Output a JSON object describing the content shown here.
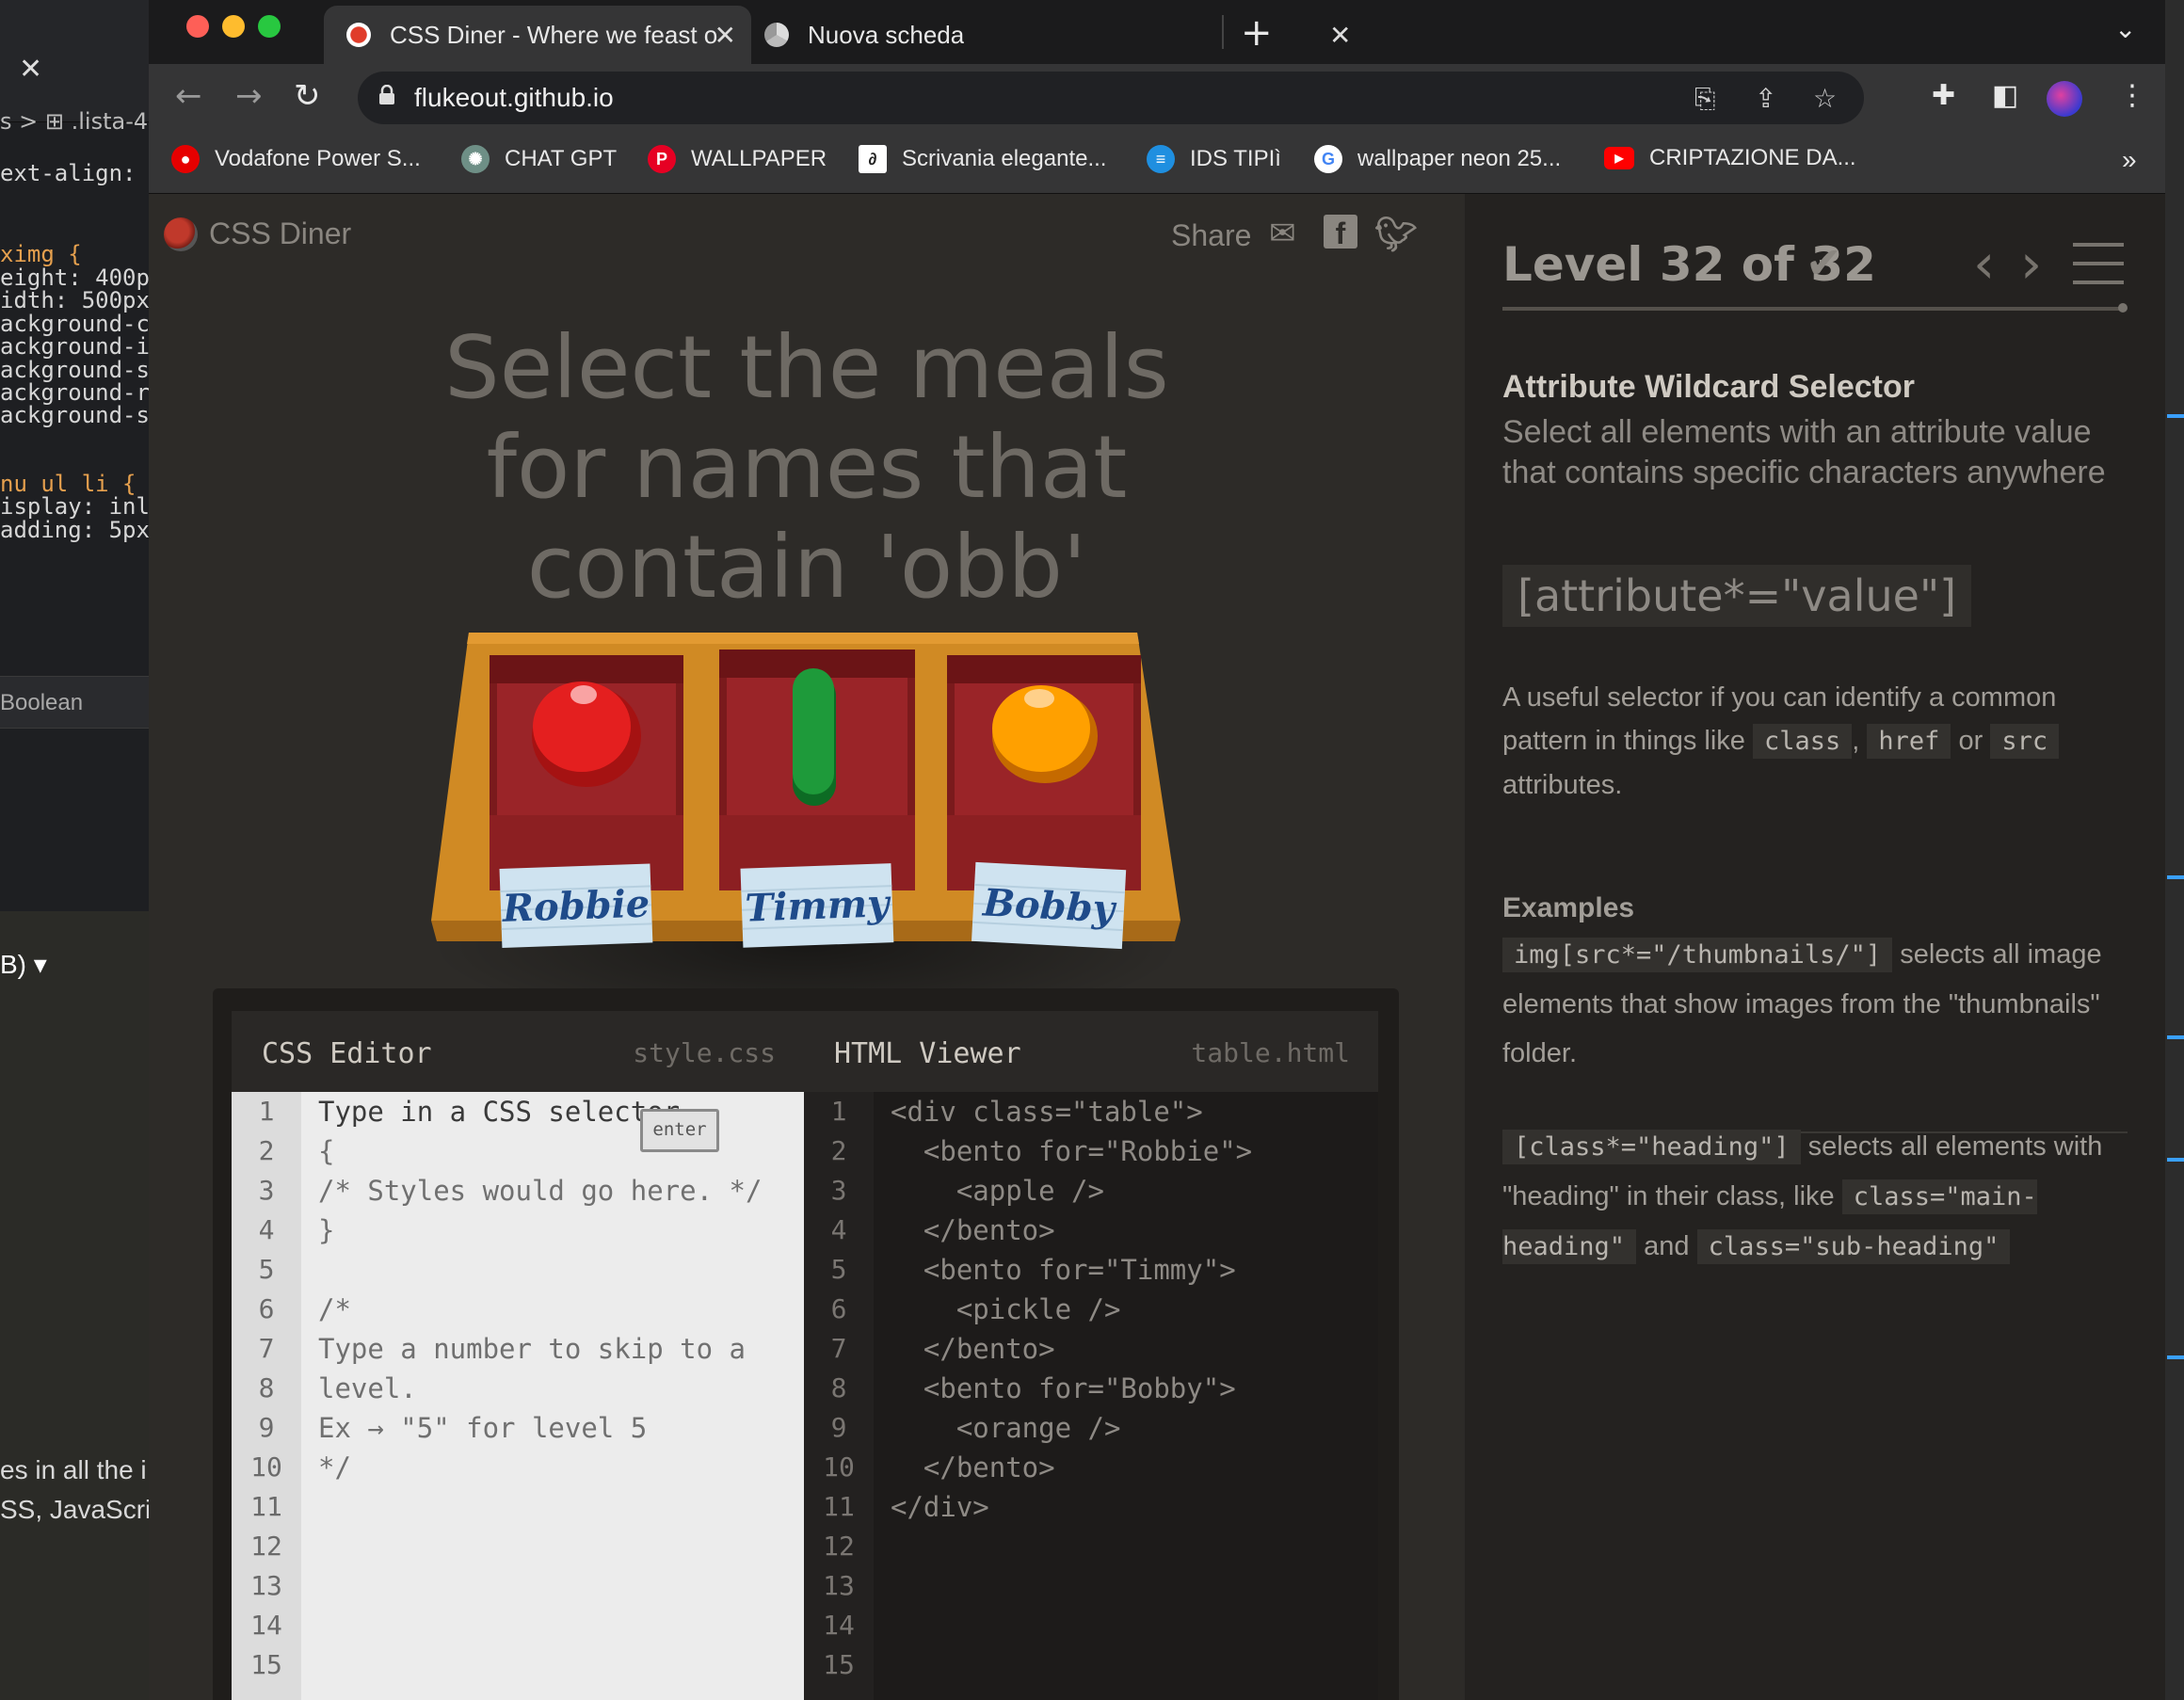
{
  "background_window": {
    "breadcrumb": "s > ⊞ .lista-4",
    "code_lines": [
      {
        "text": "ext-align:",
        "kind": "prop"
      },
      {
        "text": "ximg {",
        "kind": "sel"
      },
      {
        "text": "eight: 400p",
        "kind": "prop"
      },
      {
        "text": "idth: 500px",
        "kind": "prop"
      },
      {
        "text": "ackground-c",
        "kind": "prop"
      },
      {
        "text": "ackground-i",
        "kind": "prop"
      },
      {
        "text": "ackground-s",
        "kind": "prop"
      },
      {
        "text": "ackground-r",
        "kind": "prop"
      },
      {
        "text": "ackground-s",
        "kind": "prop"
      },
      {
        "text": "nu ul li {",
        "kind": "sel"
      },
      {
        "text": "isplay: inl",
        "kind": "prop"
      },
      {
        "text": "adding: 5px",
        "kind": "prop"
      }
    ],
    "boolean_label": "Boolean",
    "dropdown_label": "B) ▾",
    "lower_text_1": "es in all the i",
    "lower_text_2": "SS, JavaScri"
  },
  "browser": {
    "tabs": [
      {
        "title": "CSS Diner - Where we feast on",
        "active": true
      },
      {
        "title": "Nuova scheda",
        "active": false
      }
    ],
    "url": "flukeout.github.io",
    "bookmarks": [
      {
        "label": "Vodafone Power S...",
        "icon_color": "#e60000"
      },
      {
        "label": "CHAT GPT",
        "icon_color": "#6e8f86"
      },
      {
        "label": "WALLPAPER",
        "icon_color": "#e60023"
      },
      {
        "label": "Scrivania elegante...",
        "icon_color": "#ffffff"
      },
      {
        "label": "IDS TIPIì",
        "icon_color": "#1f8fe0"
      },
      {
        "label": "wallpaper neon 25...",
        "icon_color": "#ffffff"
      },
      {
        "label": "CRIPTAZIONE DA...",
        "icon_color": "#ff0000"
      }
    ],
    "overflow": "»"
  },
  "game": {
    "logo_text": "CSS Diner",
    "share_label": "Share",
    "instruction": "Select the meals for names that contain 'obb'",
    "bentos": [
      {
        "name": "Robbie",
        "food": "apple"
      },
      {
        "name": "Timmy",
        "food": "pickle"
      },
      {
        "name": "Bobby",
        "food": "orange"
      }
    ],
    "css_editor": {
      "title": "CSS Editor",
      "file": "style.css",
      "enter_label": "enter",
      "lines": [
        "Type in a CSS selector",
        "{",
        "/* Styles would go here. */",
        "}",
        "",
        "/*",
        "Type a number to skip to a",
        "level.",
        "Ex → \"5\" for level 5",
        "*/",
        "",
        "",
        "",
        "",
        ""
      ],
      "line_numbers": [
        "1",
        "2",
        "3",
        "4",
        "5",
        "6",
        "7",
        "8",
        "9",
        "10",
        "11",
        "12",
        "13",
        "14",
        "15"
      ]
    },
    "html_viewer": {
      "title": "HTML Viewer",
      "file": "table.html",
      "lines": [
        "<div class=\"table\">",
        "  <bento for=\"Robbie\">",
        "    <apple />",
        "  </bento>",
        "  <bento for=\"Timmy\">",
        "    <pickle />",
        "  </bento>",
        "  <bento for=\"Bobby\">",
        "    <orange />",
        "  </bento>",
        "</div>",
        "",
        "",
        "",
        ""
      ],
      "line_numbers": [
        "1",
        "2",
        "3",
        "4",
        "5",
        "6",
        "7",
        "8",
        "9",
        "10",
        "11",
        "12",
        "13",
        "14",
        "15"
      ]
    }
  },
  "sidebar": {
    "level_label": "Level 32 of 32",
    "level_check": "✔",
    "progress": 1.0,
    "selector_name": "Attribute Wildcard Selector",
    "selector_desc": "Select all elements with an attribute value that contains specific characters anywhere",
    "syntax": "[attribute*=\"value\"]",
    "hint_pre": "A useful selector if you can identify a common pattern in things like",
    "hint_code_1": "class",
    "hint_code_2": "href",
    "hint_or": "or",
    "hint_code_3": "src",
    "hint_post": "attributes.",
    "examples_title": "Examples",
    "example_1_code": "img[src*=\"/thumbnails/\"]",
    "example_1_text": "selects all image elements that show images from the \"thumbnails\" folder.",
    "example_2_code": "[class*=\"heading\"]",
    "example_2_text": "selects all elements with \"heading\" in their class, like",
    "example_2_code_b": "class=\"main-heading\"",
    "example_2_and": "and",
    "example_2_code_c": "class=\"sub-heading\""
  }
}
